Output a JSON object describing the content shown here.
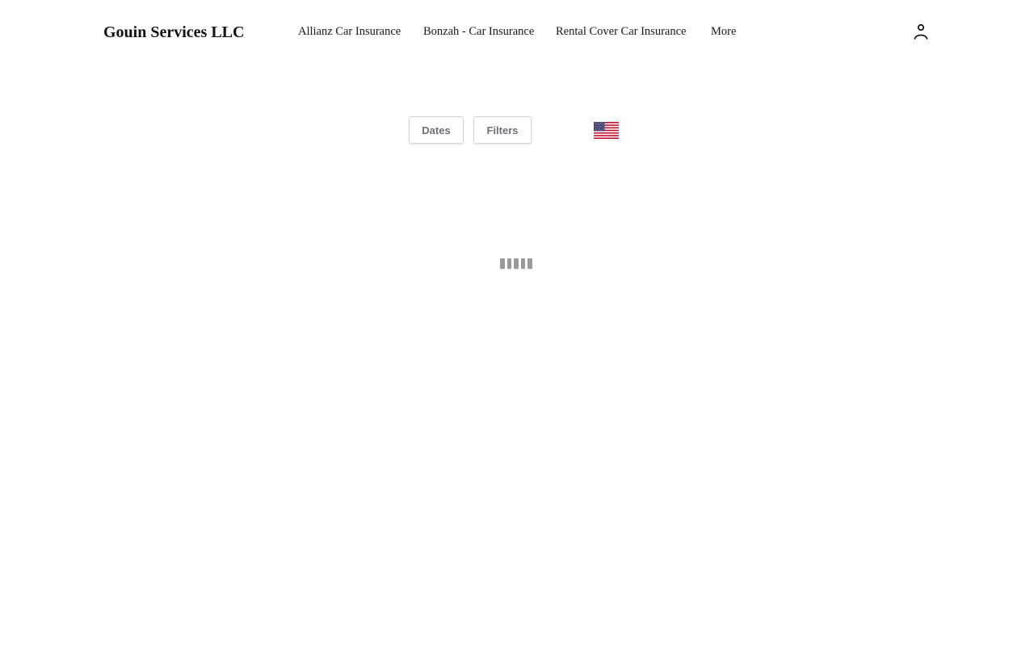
{
  "header": {
    "brand": "Gouin Services LLC",
    "nav": [
      {
        "label": "Allianz Car Insurance"
      },
      {
        "label": "Bonzah - Car Insurance"
      },
      {
        "label": "Rental Cover Car Insurance"
      },
      {
        "label": "More"
      }
    ],
    "account_icon": "user-icon"
  },
  "toolbar": {
    "dates_label": "Dates",
    "filters_label": "Filters",
    "language_flag": "us-flag-icon"
  },
  "content": {
    "loading_indicator": "loading-bars-icon"
  },
  "colors": {
    "button_text": "#6b7079",
    "button_border": "#cfd3d8",
    "loader": "#9a9a9a",
    "flag_red": "#c8102e",
    "flag_blue": "#3c3b6e"
  }
}
